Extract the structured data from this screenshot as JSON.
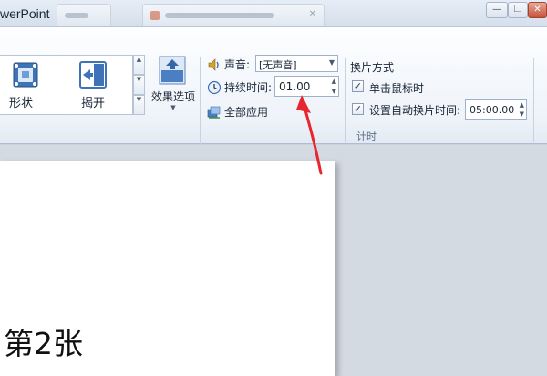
{
  "window": {
    "app_title": "werPoint",
    "minimize_symbol": "—",
    "restore_symbol": "❐",
    "close_symbol": "✕"
  },
  "ribbon": {
    "gallery": {
      "items": [
        {
          "label": "形状",
          "icon": "shape-transition-icon"
        },
        {
          "label": "揭开",
          "icon": "uncover-transition-icon"
        }
      ]
    },
    "effect_options": {
      "label": "效果选项",
      "icon": "effect-options-icon"
    },
    "timing": {
      "sound_label": "声音:",
      "sound_value": "[无声音]",
      "duration_label": "持续时间:",
      "duration_value": "01.00",
      "apply_all_label": "全部应用",
      "advance_title": "换片方式",
      "on_click_label": "单击鼠标时",
      "after_label": "设置自动换片时间:",
      "after_value": "05:00.00",
      "group_label": "计时"
    }
  },
  "slide": {
    "text": "第2张"
  },
  "annotation": {
    "arrow_color": "#e8262f"
  }
}
